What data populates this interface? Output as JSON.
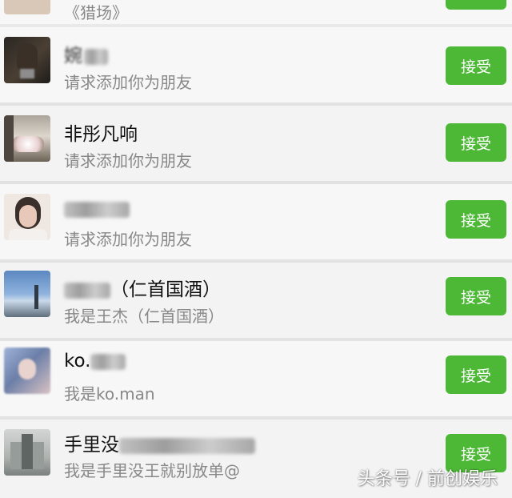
{
  "top_partial": {
    "message": "《猎场》"
  },
  "requests": [
    {
      "name": "婉",
      "message": "请求添加你为朋友",
      "button": "接受",
      "avatar": "portrait-dark-avatar"
    },
    {
      "name": "非彤凡响",
      "message": "请求添加你为朋友",
      "button": "接受",
      "avatar": "flowers-avatar"
    },
    {
      "name": "",
      "message": "请求添加你为朋友",
      "button": "接受",
      "avatar": "woman-portrait-avatar"
    },
    {
      "name": "（仁首国酒）",
      "message": "我是王杰（仁首国酒）",
      "button": "接受",
      "avatar": "landscape-avatar"
    },
    {
      "name": "ko.",
      "message": "我是ko.man",
      "button": "接受",
      "avatar": "blurred-avatar"
    },
    {
      "name": "手里没",
      "message": "我是手里没王就别放单@",
      "button": "接受",
      "avatar": "building-avatar"
    }
  ],
  "watermark": "头条号 / 前创娱乐",
  "colors": {
    "accept_green": "#4cb836",
    "row_bg": "#f7f7f7",
    "secondary_text": "#888888"
  }
}
